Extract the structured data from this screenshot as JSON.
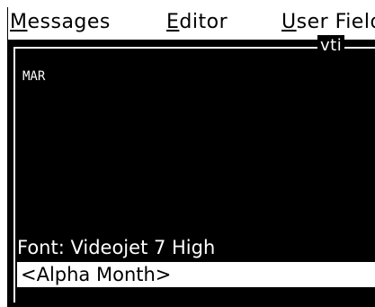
{
  "menu": {
    "messages": {
      "hotkey": "M",
      "rest": "essages"
    },
    "editor": {
      "hotkey": "E",
      "rest": "ditor"
    },
    "user_field": {
      "hotkey": "U",
      "rest": "ser Field"
    }
  },
  "panel": {
    "title": "vti",
    "field_code": "MAR",
    "font_info": "Font: Videojet 7 High",
    "selected_field": "<Alpha Month>"
  },
  "colors": {
    "screen_bg": "#000000",
    "text_on_screen": "#ffffff",
    "highlight_bg": "#ffffff",
    "highlight_text": "#000000"
  }
}
